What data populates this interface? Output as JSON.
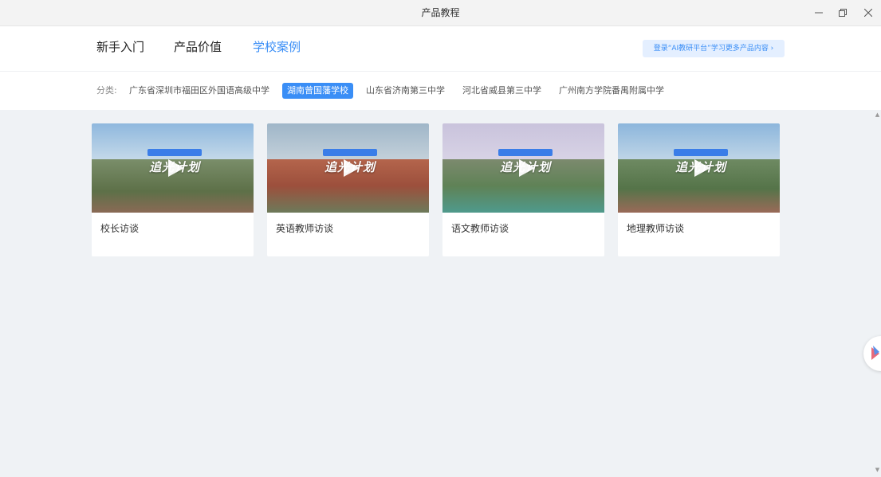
{
  "window": {
    "title": "产品教程",
    "controls": [
      "minimize-icon",
      "restore-icon",
      "close-icon"
    ]
  },
  "nav": {
    "tabs": [
      {
        "label": "新手入门",
        "active": false
      },
      {
        "label": "产品价值",
        "active": false
      },
      {
        "label": "学校案例",
        "active": true
      }
    ],
    "login_text": "登录“AI教研平台”学习更多产品内容 ›"
  },
  "category": {
    "label": "分类:",
    "items": [
      {
        "label": "广东省深圳市福田区外国语高级中学",
        "active": false
      },
      {
        "label": "湖南曾国藩学校",
        "active": true
      },
      {
        "label": "山东省济南第三中学",
        "active": false
      },
      {
        "label": "河北省威县第三中学",
        "active": false
      },
      {
        "label": "广州南方学院番禺附属中学",
        "active": false
      }
    ]
  },
  "videos": [
    {
      "caption": "校长访谈",
      "slogan": "追光计划",
      "icon": "play-icon"
    },
    {
      "caption": "英语教师访谈",
      "slogan": "追光计划",
      "icon": "play-icon"
    },
    {
      "caption": "语文教师访谈",
      "slogan": "追光计划",
      "icon": "play-icon"
    },
    {
      "caption": "地理教师访谈",
      "slogan": "追光计划",
      "icon": "play-icon"
    }
  ],
  "colors": {
    "accent": "#3a8ef6",
    "background": "#eff2f5"
  }
}
